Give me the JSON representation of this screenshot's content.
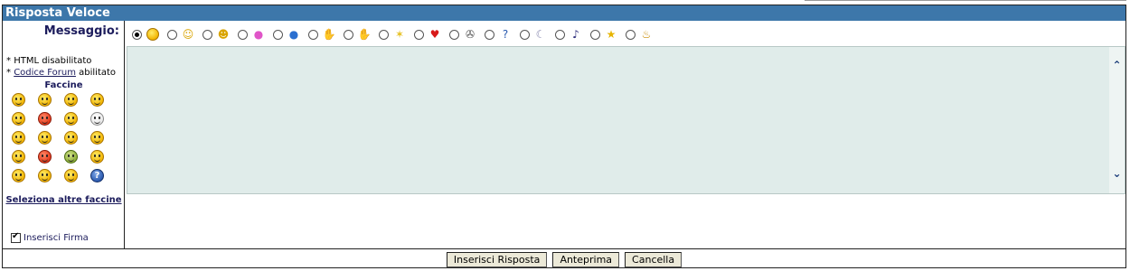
{
  "panel": {
    "title": "Risposta Veloce"
  },
  "message_label": "Messaggio:",
  "info": {
    "html_prefix": "* ",
    "html_status": "HTML disabilitato",
    "forum_prefix": "* ",
    "forum_link": "Codice Forum",
    "forum_status": "abilitato"
  },
  "faccine": {
    "title": "Faccine",
    "smileys": [
      {
        "icon": "smile-icon",
        "tone": "yellow"
      },
      {
        "icon": "big-grin-icon",
        "tone": "yellow"
      },
      {
        "icon": "cool-sunglasses-icon",
        "tone": "yellow"
      },
      {
        "icon": "blush-icon",
        "tone": "yellow"
      },
      {
        "icon": "tongue-out-icon",
        "tone": "yellow"
      },
      {
        "icon": "angry-devil-icon",
        "tone": "red"
      },
      {
        "icon": "wink-icon",
        "tone": "yellow"
      },
      {
        "icon": "clown-icon",
        "tone": "white"
      },
      {
        "icon": "confused-icon",
        "tone": "yellow"
      },
      {
        "icon": "sad-icon",
        "tone": "yellow"
      },
      {
        "icon": "frown-icon",
        "tone": "yellow"
      },
      {
        "icon": "embarrassed-icon",
        "tone": "yellow"
      },
      {
        "icon": "shocked-icon",
        "tone": "yellow"
      },
      {
        "icon": "angry-icon",
        "tone": "red"
      },
      {
        "icon": "sick-icon",
        "tone": "green"
      },
      {
        "icon": "sleepy-icon",
        "tone": "yellow"
      },
      {
        "icon": "surprised-icon",
        "tone": "yellow"
      },
      {
        "icon": "neutral-icon",
        "tone": "yellow"
      },
      {
        "icon": "kiss-icon",
        "tone": "yellow"
      },
      {
        "icon": "question-icon",
        "tone": "question",
        "glyph": "?"
      }
    ],
    "more_link": "Seleziona altre faccine"
  },
  "signature": {
    "label": "Inserisci Firma",
    "checked": true
  },
  "message_icons": [
    {
      "icon": "none-selected",
      "glyph": "",
      "color": "#000",
      "selected": true
    },
    {
      "icon": "smiley-icon",
      "glyph": "☺",
      "color": "#d9a400",
      "selected": false
    },
    {
      "icon": "big-grin-icon",
      "glyph": "☻",
      "color": "#d9a400",
      "selected": false
    },
    {
      "icon": "surprised-pink-icon",
      "glyph": "●",
      "color": "#e055c8",
      "selected": false
    },
    {
      "icon": "sad-blue-icon",
      "glyph": "●",
      "color": "#2a6fd0",
      "selected": false
    },
    {
      "icon": "thumbs-down-icon",
      "glyph": "✋",
      "color": "#e6a020",
      "selected": false
    },
    {
      "icon": "thumbs-up-icon",
      "glyph": "✋",
      "color": "#e6a020",
      "selected": false
    },
    {
      "icon": "lightbulb-icon",
      "glyph": "✶",
      "color": "#e6c020",
      "selected": false
    },
    {
      "icon": "heart-icon",
      "glyph": "♥",
      "color": "#d81a1a",
      "selected": false
    },
    {
      "icon": "gear-icon",
      "glyph": "✇",
      "color": "#555555",
      "selected": false
    },
    {
      "icon": "help-icon",
      "glyph": "?",
      "color": "#2a5bb0",
      "selected": false
    },
    {
      "icon": "moon-icon",
      "glyph": "☾",
      "color": "#8a8ab0",
      "selected": false
    },
    {
      "icon": "music-note-icon",
      "glyph": "♪",
      "color": "#2a2a7a",
      "selected": false
    },
    {
      "icon": "star-icon",
      "glyph": "★",
      "color": "#e6b400",
      "selected": false
    },
    {
      "icon": "cake-icon",
      "glyph": "♨",
      "color": "#c98a00",
      "selected": false
    }
  ],
  "message_text": "",
  "buttons": {
    "submit": "Inserisci Risposta",
    "preview": "Anteprima",
    "cancel": "Cancella"
  }
}
